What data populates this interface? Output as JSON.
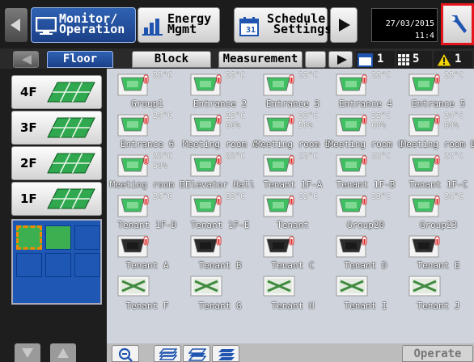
{
  "header": {
    "monitor_label_1": "Monitor/",
    "monitor_label_2": "Operation",
    "energy_label_1": "Energy",
    "energy_label_2": "Mgmt",
    "schedule_label_1": "Schedule",
    "schedule_label_2": "Settings",
    "calendar_day": "31",
    "date": "27/03/2015",
    "time": "11:4"
  },
  "tabs": {
    "floor": "Floor",
    "block": "Block",
    "measurement": "Measurement",
    "calendar_count": "1",
    "grid_count": "5",
    "alert_count": "1"
  },
  "floors": [
    {
      "label": "4F"
    },
    {
      "label": "3F"
    },
    {
      "label": "2F"
    },
    {
      "label": "1F"
    }
  ],
  "units": [
    {
      "name": "Group1",
      "temp": "22°C",
      "humidity": "",
      "type": "cassette"
    },
    {
      "name": "Entrance 2",
      "temp": "22°C",
      "humidity": "",
      "type": "cassette"
    },
    {
      "name": "Entrance 3",
      "temp": "22°C",
      "humidity": "",
      "type": "cassette"
    },
    {
      "name": "Entrance 4",
      "temp": "22°C",
      "humidity": "",
      "type": "cassette"
    },
    {
      "name": "Entrance 5",
      "temp": "22°C",
      "humidity": "",
      "type": "cassette"
    },
    {
      "name": "Entrance 6",
      "temp": "24°C",
      "humidity": "",
      "type": "cassette"
    },
    {
      "name": "Meeting room A",
      "temp": "22°C",
      "humidity": "60%",
      "type": "cassette"
    },
    {
      "name": "Meeting room B",
      "temp": "23°C",
      "humidity": "50%",
      "type": "cassette"
    },
    {
      "name": "Meeting room C",
      "temp": "22°C",
      "humidity": "60%",
      "type": "cassette"
    },
    {
      "name": "Meeting room D",
      "temp": "24°C",
      "humidity": "60%",
      "type": "cassette"
    },
    {
      "name": "Meeting room E",
      "temp": "23°C",
      "humidity": "50%",
      "type": "cassette"
    },
    {
      "name": "Elevator Hall",
      "temp": "23°C",
      "humidity": "",
      "type": "cassette"
    },
    {
      "name": "Tenant 1F-A",
      "temp": "22°C",
      "humidity": "",
      "type": "cassette"
    },
    {
      "name": "Tenant 1F-B",
      "temp": "22°C",
      "humidity": "",
      "type": "cassette"
    },
    {
      "name": "Tenant 1F-C",
      "temp": "22°C",
      "humidity": "",
      "type": "cassette"
    },
    {
      "name": "Tenant 1F-D",
      "temp": "24°C",
      "humidity": "",
      "type": "cassette"
    },
    {
      "name": "Tenant 1F-E",
      "temp": "23°C",
      "humidity": "",
      "type": "cassette"
    },
    {
      "name": "Tenant",
      "temp": "22°C",
      "humidity": "",
      "type": "cassette"
    },
    {
      "name": "Group20",
      "temp": "23°C",
      "humidity": "",
      "type": "cassette"
    },
    {
      "name": "Group23",
      "temp": "24°C",
      "humidity": "",
      "type": "cassette"
    },
    {
      "name": "Tenant A",
      "temp": "",
      "humidity": "",
      "type": "dark-cassette"
    },
    {
      "name": "Tenant B",
      "temp": "",
      "humidity": "",
      "type": "dark-cassette"
    },
    {
      "name": "Tenant C",
      "temp": "",
      "humidity": "",
      "type": "dark-cassette"
    },
    {
      "name": "Tenant D",
      "temp": "",
      "humidity": "",
      "type": "dark-cassette"
    },
    {
      "name": "Tenant E",
      "temp": "",
      "humidity": "",
      "type": "dark-cassette"
    },
    {
      "name": "Tenant F",
      "temp": "",
      "humidity": "",
      "type": "ventilator"
    },
    {
      "name": "Tenant G",
      "temp": "",
      "humidity": "",
      "type": "ventilator"
    },
    {
      "name": "Tenant H",
      "temp": "",
      "humidity": "",
      "type": "ventilator"
    },
    {
      "name": "Tenant I",
      "temp": "",
      "humidity": "",
      "type": "ventilator"
    },
    {
      "name": "Tenant J",
      "temp": "",
      "humidity": "",
      "type": "ventilator"
    }
  ],
  "footer": {
    "operate_label": "Operate"
  },
  "colors": {
    "active_tab": "#1a3f86",
    "highlight_border": "#e5161b",
    "floor_green": "#2fa84f",
    "grid_bg": "#cfd4dc"
  }
}
